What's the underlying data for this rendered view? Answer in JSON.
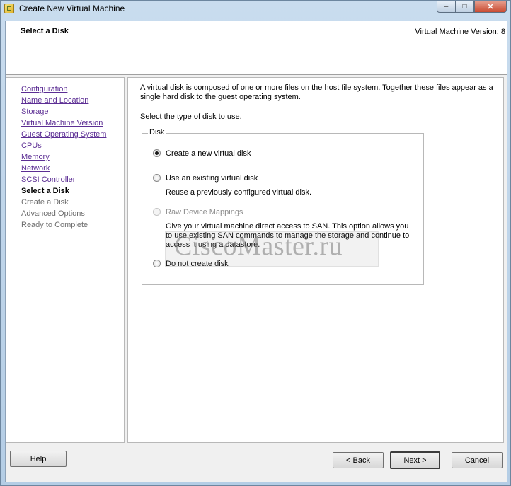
{
  "window": {
    "title": "Create New Virtual Machine",
    "controls": {
      "minimize": "–",
      "maximize": "□",
      "close": "✕"
    }
  },
  "header": {
    "title": "Select a Disk",
    "version": "Virtual Machine Version: 8"
  },
  "sidebar": {
    "steps": [
      {
        "label": "Configuration",
        "state": "link"
      },
      {
        "label": "Name and Location",
        "state": "link"
      },
      {
        "label": "Storage",
        "state": "link"
      },
      {
        "label": "Virtual Machine Version",
        "state": "link"
      },
      {
        "label": "Guest Operating System",
        "state": "link"
      },
      {
        "label": "CPUs",
        "state": "link"
      },
      {
        "label": "Memory",
        "state": "link"
      },
      {
        "label": "Network",
        "state": "link"
      },
      {
        "label": "SCSI Controller",
        "state": "link"
      },
      {
        "label": "Select a Disk",
        "state": "current"
      },
      {
        "label": "Create a Disk",
        "state": "future"
      },
      {
        "label": "Advanced Options",
        "state": "future"
      },
      {
        "label": "Ready to Complete",
        "state": "future"
      }
    ]
  },
  "main": {
    "intro": "A virtual disk is composed of one or more files on the host file system. Together these files appear as a single hard disk to the guest operating system.",
    "prompt": "Select the type of disk to use.",
    "group_title": "Disk",
    "options": [
      {
        "label": "Create a new virtual disk",
        "selected": true,
        "enabled": true,
        "description": ""
      },
      {
        "label": "Use an existing virtual disk",
        "selected": false,
        "enabled": true,
        "description": "Reuse a previously configured virtual disk."
      },
      {
        "label": "Raw Device Mappings",
        "selected": false,
        "enabled": false,
        "description": "Give your virtual machine direct access to SAN. This option allows you to use existing SAN commands to manage the storage and continue to access it using a datastore."
      },
      {
        "label": "Do not create disk",
        "selected": false,
        "enabled": true,
        "description": ""
      }
    ]
  },
  "watermark": "CiscoMaster.ru",
  "footer": {
    "help": "Help",
    "back": "< Back",
    "next": "Next >",
    "cancel": "Cancel"
  },
  "colors": {
    "link": "#5c2e94",
    "disabled_text": "#8d8d8d",
    "close_button": "#c94b32"
  }
}
